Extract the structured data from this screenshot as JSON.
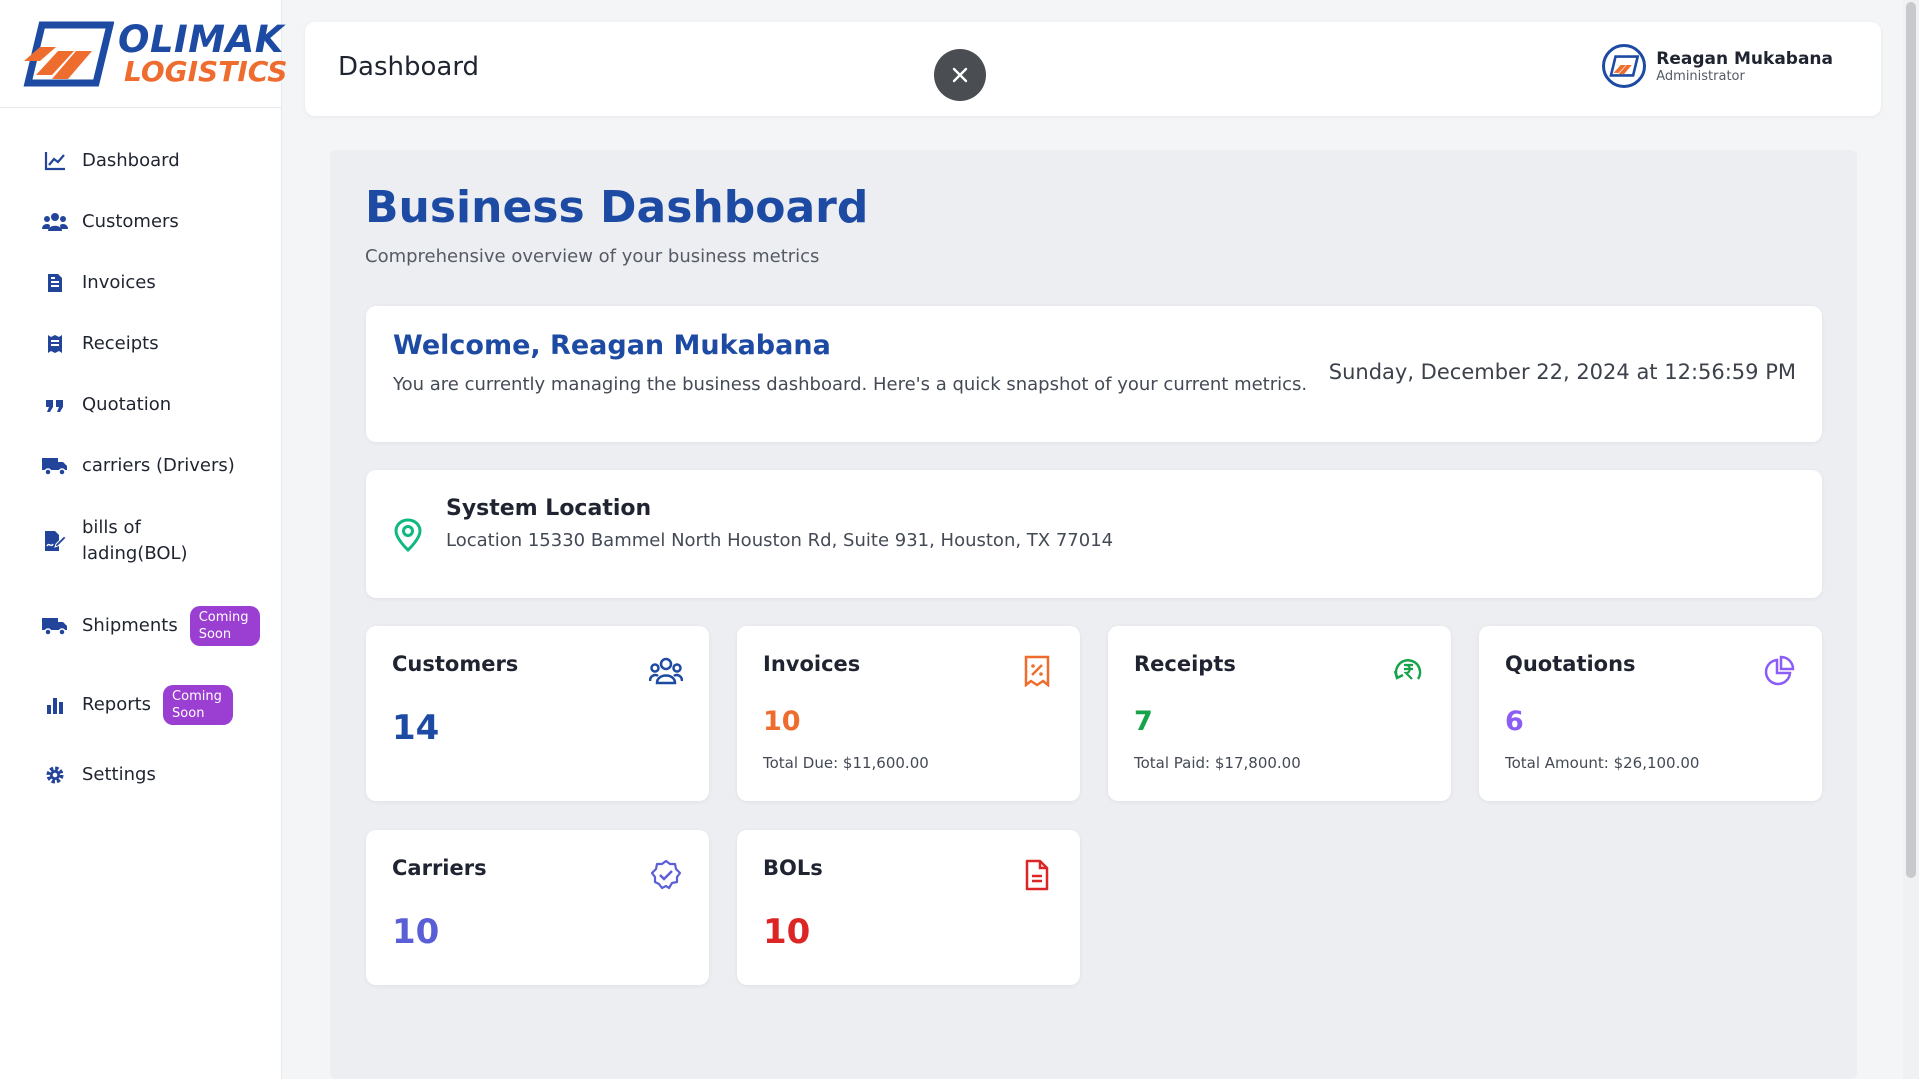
{
  "brand": {
    "line1": "OLIMAK",
    "line2": "LOGISTICS",
    "primary": "#1d4aa3",
    "accent": "#ef6c2f"
  },
  "sidebar": {
    "items": [
      {
        "label": "Dashboard",
        "icon": "chart-line-icon"
      },
      {
        "label": "Customers",
        "icon": "users-icon"
      },
      {
        "label": "Invoices",
        "icon": "file-invoice-icon"
      },
      {
        "label": "Receipts",
        "icon": "receipt-icon"
      },
      {
        "label": "Quotation",
        "icon": "quote-icon"
      },
      {
        "label": "carriers (Drivers)",
        "icon": "truck-icon"
      },
      {
        "label": "bills of lading(BOL)",
        "icon": "file-signature-icon"
      },
      {
        "label": "Shipments",
        "icon": "truck-fast-icon",
        "badge": "Coming Soon"
      },
      {
        "label": "Reports",
        "icon": "bar-chart-icon",
        "badge": "Coming Soon"
      },
      {
        "label": "Settings",
        "icon": "gear-icon"
      }
    ]
  },
  "header": {
    "title": "Dashboard",
    "user_name": "Reagan Mukabana",
    "user_role": "Administrator"
  },
  "main": {
    "title": "Business Dashboard",
    "subtitle": "Comprehensive overview of your business metrics",
    "welcome": {
      "title": "Welcome, Reagan Mukabana",
      "text": "You are currently managing the business dashboard. Here's a quick snapshot of your current metrics.",
      "datetime": "Sunday, December 22, 2024 at 12:56:59 PM"
    },
    "location": {
      "title": "System Location",
      "text": "Location 15330 Bammel North Houston Rd, Suite 931, Houston, TX 77014"
    },
    "stats": {
      "customers": {
        "title": "Customers",
        "value": "14",
        "color": "#1d4aa3"
      },
      "invoices": {
        "title": "Invoices",
        "value": "10",
        "sub": "Total Due: $11,600.00",
        "color": "#ef6c2f"
      },
      "receipts": {
        "title": "Receipts",
        "value": "7",
        "sub": "Total Paid: $17,800.00",
        "color": "#16a34a"
      },
      "quotations": {
        "title": "Quotations",
        "value": "6",
        "sub": "Total Amount: $26,100.00",
        "color": "#8b5cf6"
      },
      "carriers": {
        "title": "Carriers",
        "value": "10",
        "color": "#5b5fd6"
      },
      "bols": {
        "title": "BOLs",
        "value": "10",
        "color": "#dc2626"
      }
    }
  }
}
